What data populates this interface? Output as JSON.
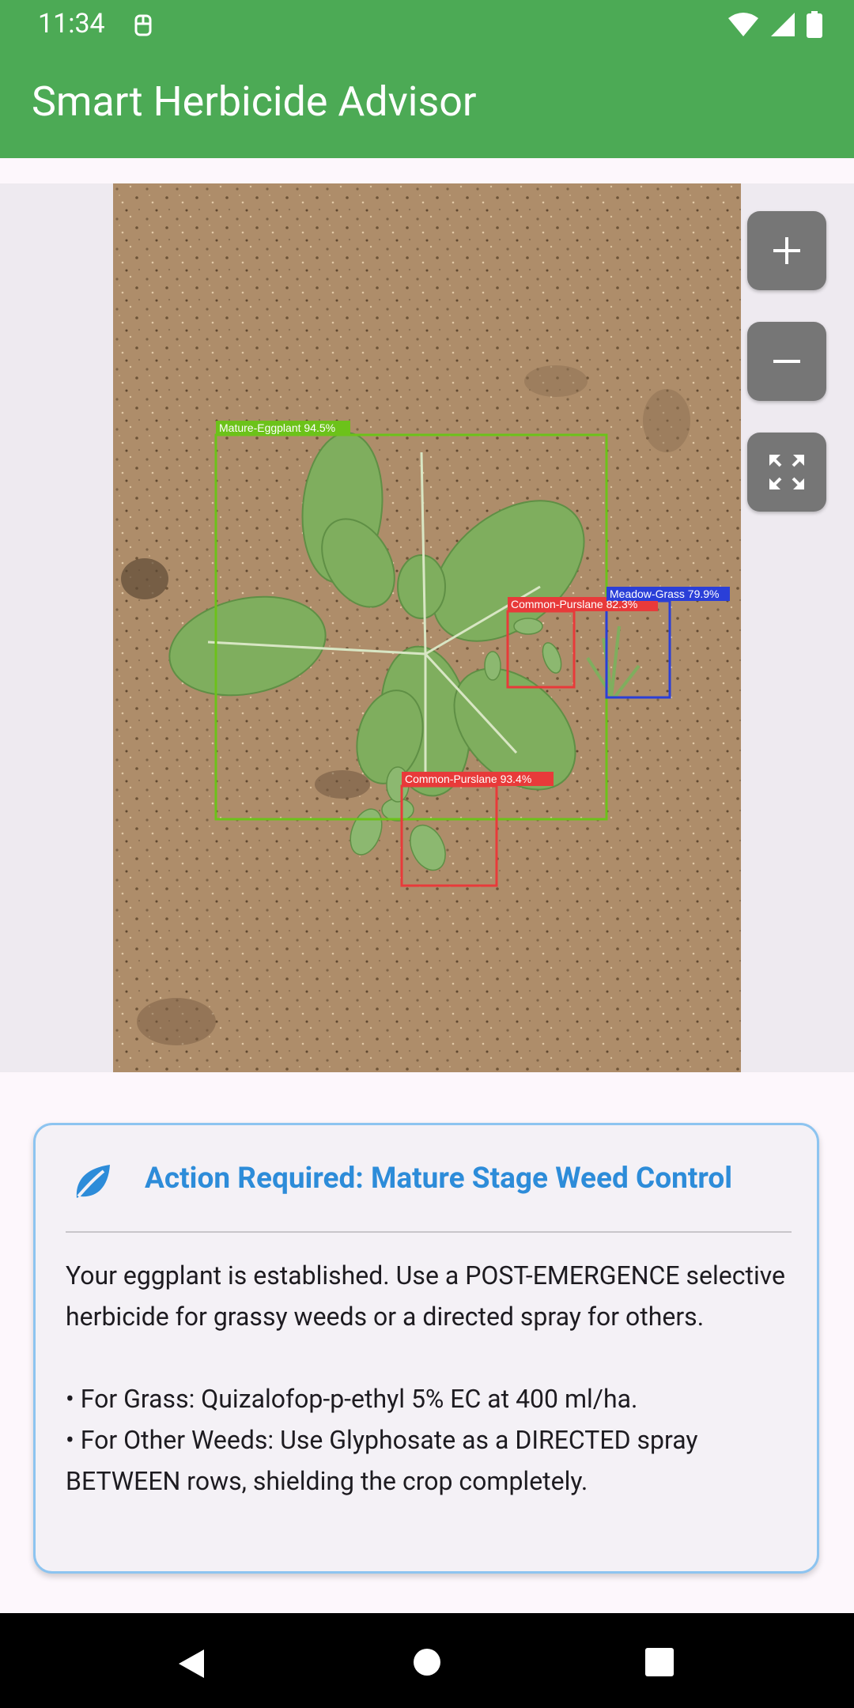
{
  "status_bar": {
    "time": "11:34"
  },
  "app_bar": {
    "title": "Smart Herbicide Advisor"
  },
  "detections": [
    {
      "label": "Mature-Eggplant  94.5%",
      "color": "#6CC21A"
    },
    {
      "label": "Common-Purslane  82.3%",
      "color": "#E83A3A"
    },
    {
      "label": "Meadow-Grass 79.9%",
      "color": "#2A3FD8"
    },
    {
      "label": "Common-Purslane  93.4%",
      "color": "#E83A3A"
    }
  ],
  "viewer_controls": {
    "zoom_in": "plus-icon",
    "zoom_out": "minus-icon",
    "fit": "fit-screen-icon"
  },
  "advice_card": {
    "title": "Action Required: Mature Stage Weed Control",
    "intro": "Your eggplant is established. Use a POST-EMERGENCE selective herbicide for grassy weeds or a directed spray for others.",
    "bullets": [
      "• For Grass: Quizalofop-p-ethyl 5% EC at 400 ml/ha.",
      "• For Other Weeds: Use Glyphosate as a DIRECTED spray BETWEEN rows, shielding the crop completely."
    ],
    "accent_color": "#2D8CD9",
    "border_color": "#8DC4F0"
  },
  "theme": {
    "app_bar_color": "#4CAA55"
  }
}
